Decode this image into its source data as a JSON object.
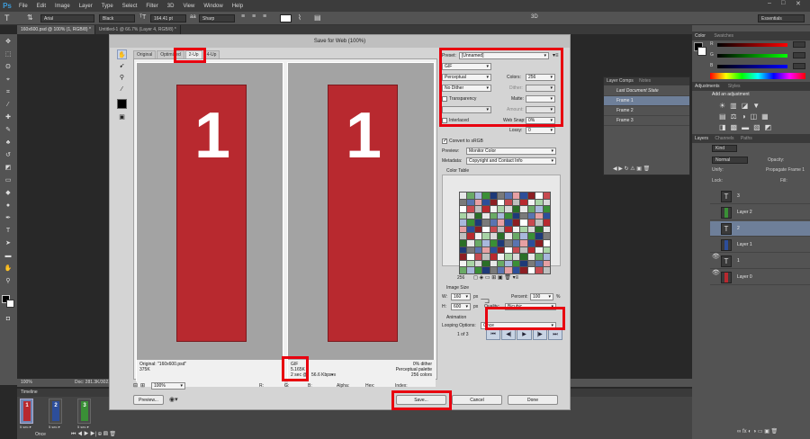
{
  "app": {
    "logo": "Ps",
    "menu": [
      "File",
      "Edit",
      "Image",
      "Layer",
      "Type",
      "Select",
      "Filter",
      "3D",
      "View",
      "Window",
      "Help"
    ],
    "window_controls": [
      "–",
      "□",
      "✕"
    ]
  },
  "options_bar": {
    "font_family": "Arial",
    "font_style": "Black",
    "font_size": "164.41 pt",
    "antialias": "Sharp",
    "mode_3d": "3D",
    "workspace": "Essentials"
  },
  "doc_tabs": [
    {
      "label": "160x600.psd @ 100% (1, RGB/8) *",
      "active": true
    },
    {
      "label": "Untitled-1 @ 66.7% (Layer 4, RGB/8) *",
      "active": false
    }
  ],
  "status": {
    "zoom": "100%",
    "doc": "Doc: 281.3K/302.0K"
  },
  "timeline": {
    "title": "Timeline",
    "frames": [
      {
        "number": "1",
        "delay": "5 sec.▾",
        "color": "#b8292f"
      },
      {
        "number": "2",
        "delay": "5 sec.▾",
        "color": "#2d4e9a"
      },
      {
        "number": "3",
        "delay": "5 sec.▾",
        "color": "#3a8f36"
      }
    ],
    "loop": "Once"
  },
  "right_panels": {
    "color_tabs": [
      "Color",
      "Swatches"
    ],
    "color_labels": [
      "R",
      "G",
      "B"
    ],
    "color_values": [
      "",
      "",
      ""
    ],
    "adjustments_tabs": [
      "Adjustments",
      "Styles"
    ],
    "adjustments_title": "Add an adjustment",
    "layers_tabs": [
      "Layers",
      "Channels",
      "Paths"
    ],
    "kind": "Kind",
    "blend": "Normal",
    "opacity_label": "Opacity:",
    "unify": "Unify:",
    "propagate": "Propagate Frame 1",
    "lock_label": "Lock:",
    "fill_label": "Fill:",
    "layers": [
      {
        "name": "3",
        "type": "T",
        "selected": false
      },
      {
        "name": "Layer 2",
        "type": "img",
        "selected": false,
        "color": "#3a8f36"
      },
      {
        "name": "2",
        "type": "T",
        "selected": true
      },
      {
        "name": "Layer 1",
        "type": "img",
        "selected": false,
        "color": "#2d4e9a"
      },
      {
        "name": "1",
        "type": "T",
        "selected": false
      },
      {
        "name": "Layer 0",
        "type": "img",
        "selected": false,
        "color": "#b8292f"
      }
    ]
  },
  "layer_comps": {
    "tabs": [
      "Layer Comps",
      "Notes"
    ],
    "items": [
      "Last Document State",
      "Frame 1",
      "Frame 2",
      "Frame 3"
    ]
  },
  "dialog": {
    "title": "Save for Web (100%)",
    "tabs": [
      "Original",
      "Optimized",
      "2-Up",
      "4-Up"
    ],
    "active_tab": "2-Up",
    "left_pane": {
      "big_number": "1",
      "info_line1": "Original: \"160x600.psd\"",
      "info_line2": "375K"
    },
    "right_pane": {
      "big_number": "1",
      "format": "GIF",
      "size": "5.165K",
      "time": "2 sec @",
      "rate": "56.6 Kbps",
      "dither_info": "0% dither",
      "palette_info": "Perceptual palette",
      "colors_info": "256 colors"
    },
    "settings": {
      "preset_label": "Preset:",
      "preset_value": "[Unnamed]",
      "format": "GIF",
      "reduction": "Perceptual",
      "colors_label": "Colors:",
      "colors_value": "256",
      "dither_algo": "No Dither",
      "dither_label": "Dither:",
      "transparency": "Transparency",
      "matte_label": "Matte:",
      "amount_label": "Amount:",
      "interlaced": "Interlaced",
      "websnap_label": "Web Snap:",
      "websnap_value": "0%",
      "lossy_label": "Lossy:",
      "lossy_value": "0",
      "convert_srgb": "Convert to sRGB",
      "preview_label": "Preview:",
      "preview_value": "Monitor Color",
      "metadata_label": "Metadata:",
      "metadata_value": "Copyright and Contact Info",
      "color_table_label": "Color Table",
      "color_count": "256",
      "image_size_label": "Image Size",
      "w_label": "W:",
      "w_value": "160",
      "h_label": "H:",
      "h_value": "600",
      "px": "px",
      "percent_label": "Percent:",
      "percent_value": "100",
      "percent_unit": "%",
      "quality_label": "Quality:",
      "quality_value": "Bicubic",
      "animation_label": "Animation",
      "looping_label": "Looping Options:",
      "looping_value": "Once",
      "frame_counter": "1 of 3"
    },
    "bottom": {
      "zoom": "100%",
      "r_label": "R:",
      "g_label": "G:",
      "b_label": "B:",
      "alpha_label": "Alpha:",
      "hex_label": "Hex:",
      "index_label": "Index:",
      "preview_button": "Preview...",
      "save_button": "Save...",
      "cancel_button": "Cancel",
      "done_button": "Done"
    }
  },
  "colors": {
    "accent_red": "#e8000f",
    "poster_red": "#b8292f",
    "panel_dark": "#535353"
  }
}
